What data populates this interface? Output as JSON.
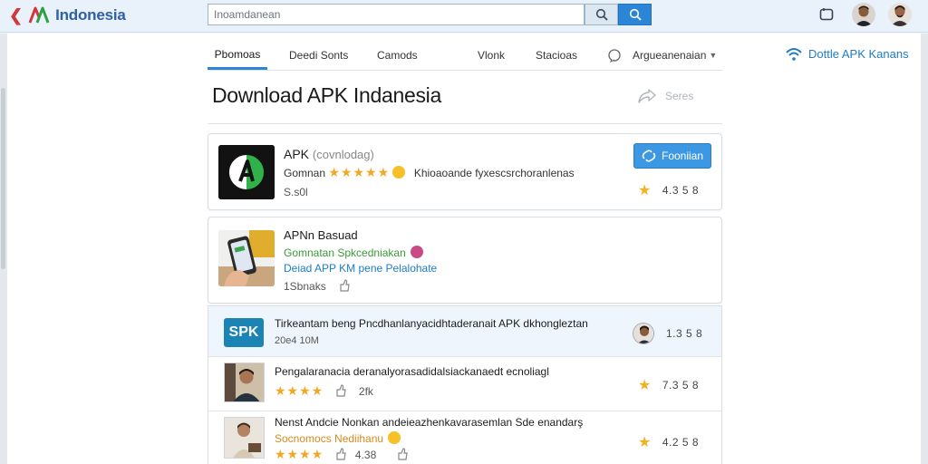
{
  "header": {
    "brand": "Indonesia",
    "search_value": "Inoamdanean",
    "colors": {
      "brand_red": "#d2383b",
      "brand_green": "#2ea043",
      "accent": "#2c86d8"
    }
  },
  "tabs": [
    {
      "label": "Pbomoas",
      "active": true
    },
    {
      "label": "Deedi Sonts",
      "active": false
    },
    {
      "label": "Camods",
      "active": false
    },
    {
      "label": "Vlonk",
      "active": false
    },
    {
      "label": "Stacioas",
      "active": false
    },
    {
      "label": "Argueanenaian",
      "active": false,
      "dropdown": true
    }
  ],
  "side_link": "Dottle APK Kanans",
  "page": {
    "title": "Download APK Indanesia",
    "share_label": "Seres"
  },
  "card1": {
    "title": "APK",
    "title_note": "(covnlodag)",
    "meta_prefix": "Gomnan",
    "stars": "★★★★★",
    "description": "Khioaoande fyxescsrchoranlenas",
    "size": "S.s0l",
    "button_label": "Fooniian",
    "rating": "4.3 5 8"
  },
  "card2": {
    "title": "APNn Basuad",
    "line1": "Gomnatan Spkcedniakan",
    "line2": "Deiad APP KM pene Pelalohate",
    "line2_link": "Pelalohate",
    "meta": "1Sbnaks"
  },
  "list": [
    {
      "icon_text": "SPK",
      "title": "Tirkeantam beng Pncdhanlanyacidhtaderanait APK dkhongleztan",
      "meta": "20e4 10M",
      "rating": "1.3 5 8"
    },
    {
      "title": "Pengalaranacia deranalyorasadidalsiackanaedt ecnoliagl",
      "stars": "★★★★",
      "meta": "2fk",
      "rating": "7.3 5 8"
    },
    {
      "title": "Nenst Andcie Nonkan andeieazhenkavarasemlan Sde enandarş",
      "sub": "Socnomocs Nediihanu",
      "stars": "★★★★",
      "meta": "4.38",
      "rating": "4.2 5 8"
    }
  ]
}
